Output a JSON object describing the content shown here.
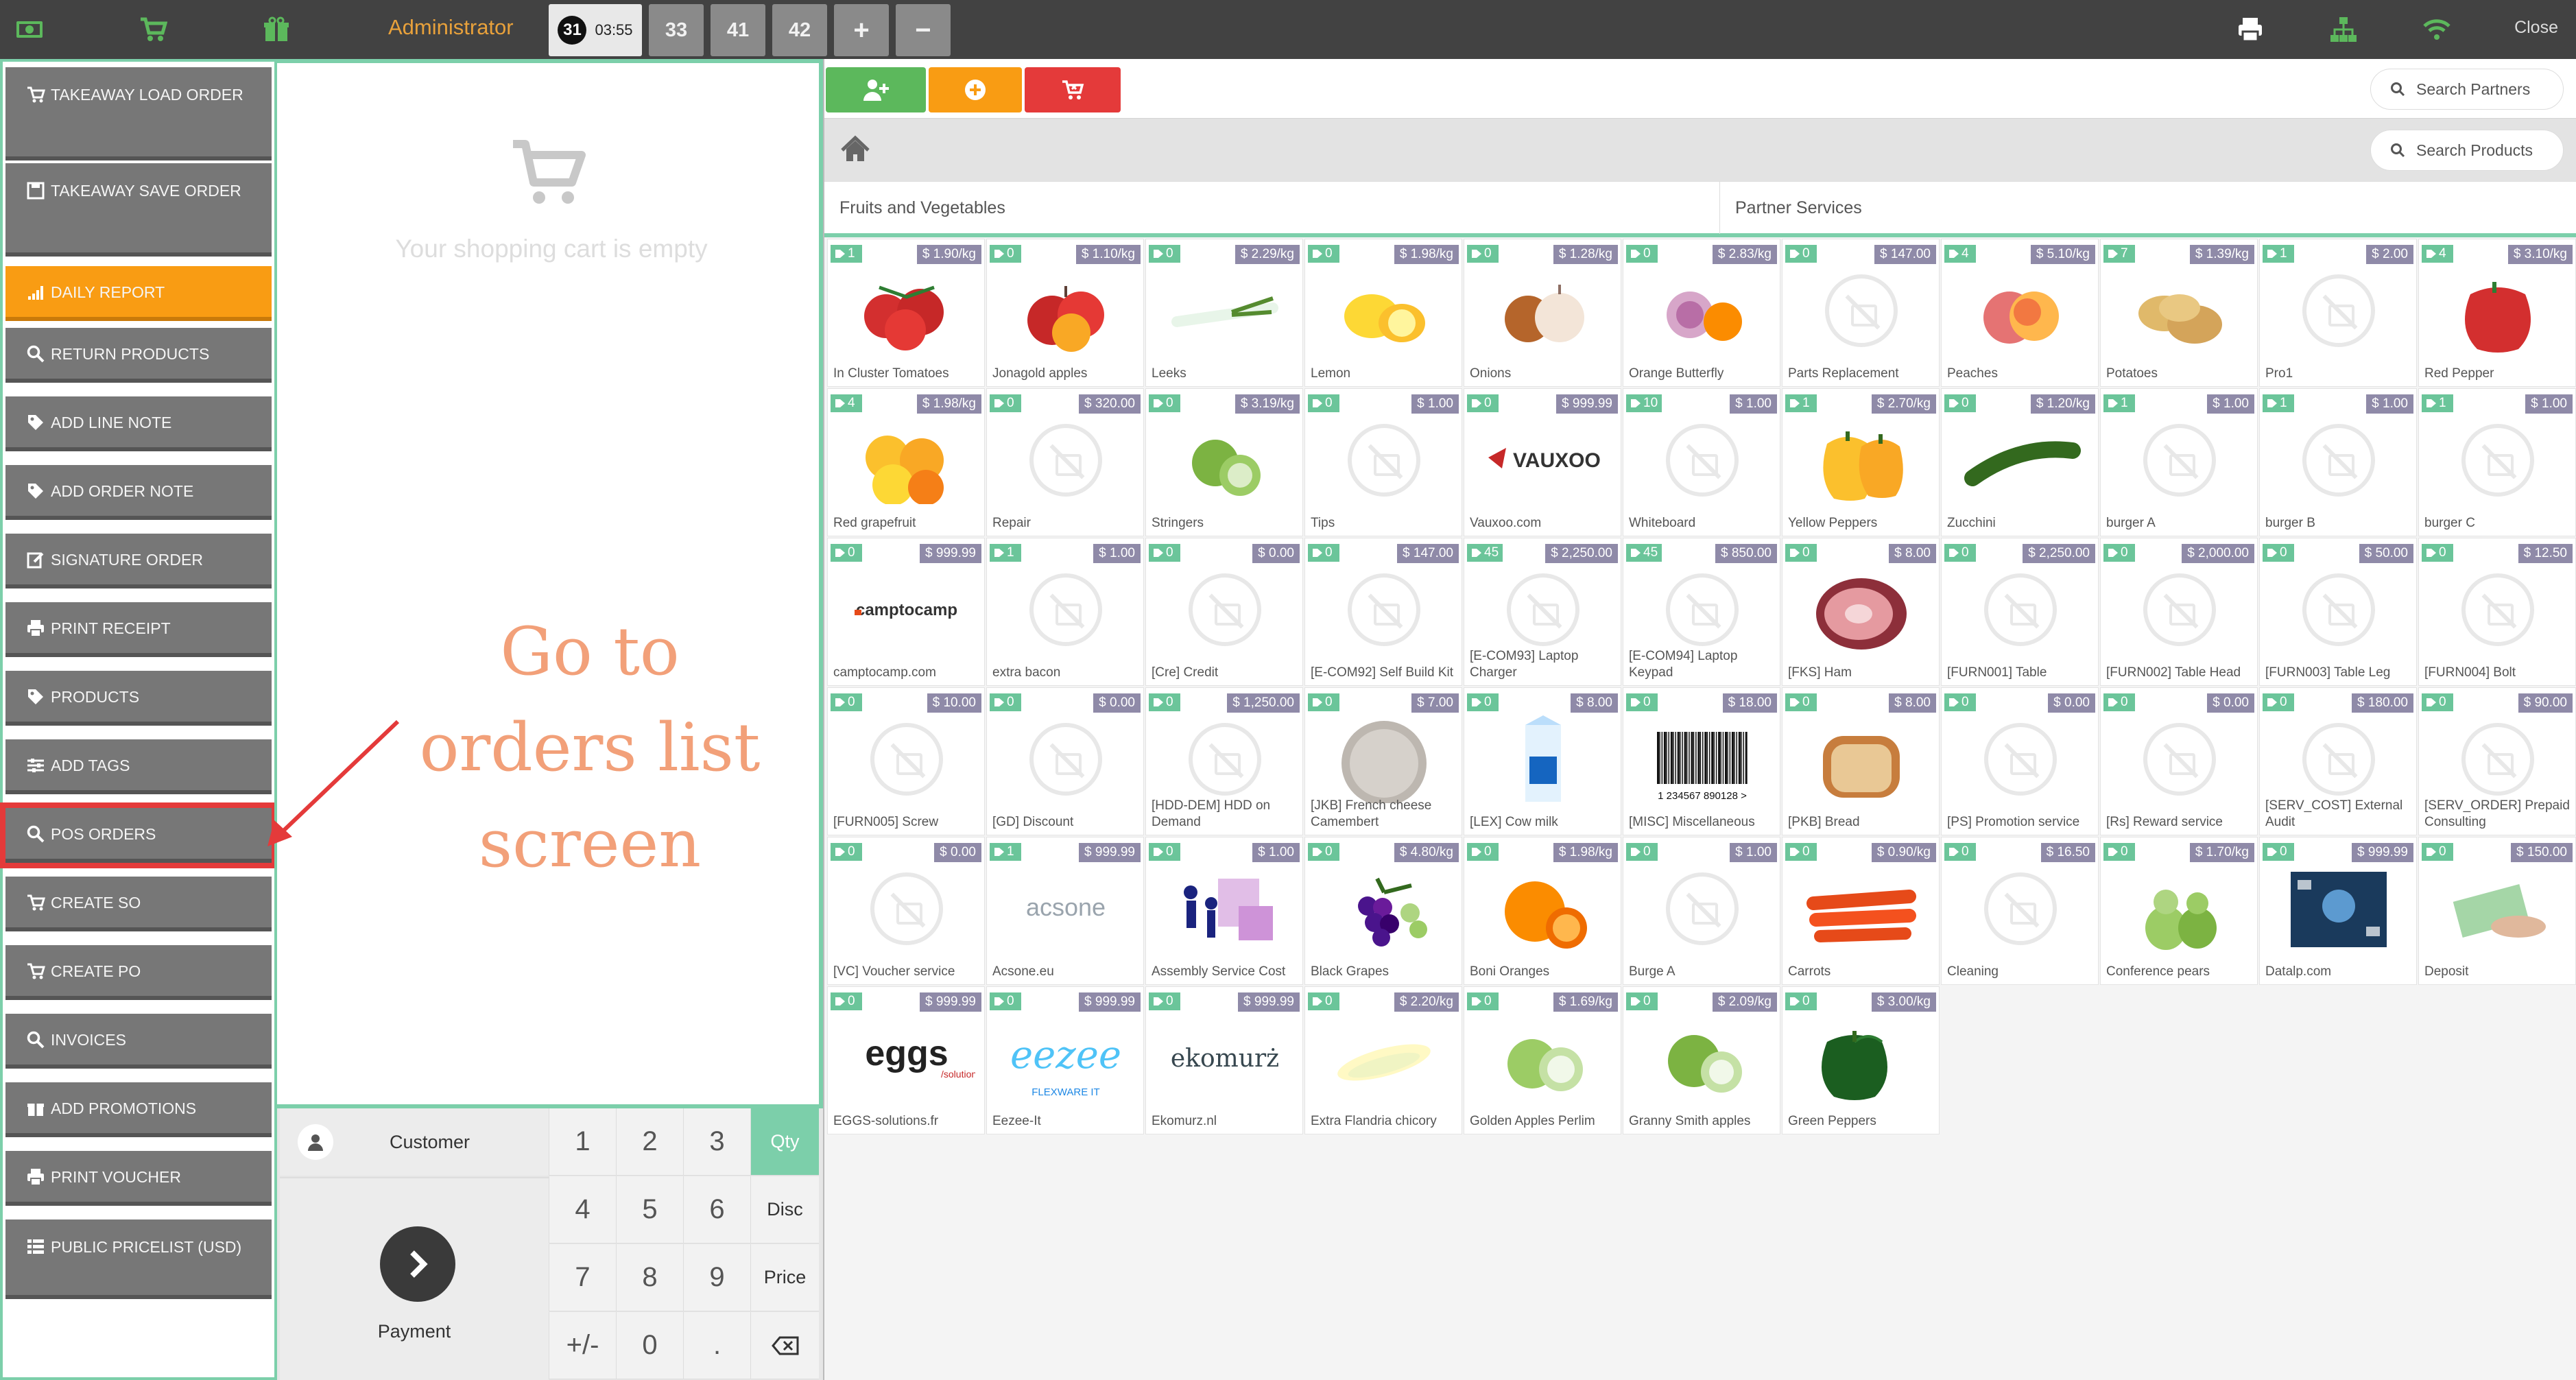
{
  "topbar": {
    "user": "Administrator",
    "tabs": [
      {
        "num": "31",
        "time": "03:55",
        "active": true
      },
      {
        "label": "33"
      },
      {
        "label": "41"
      },
      {
        "label": "42"
      },
      {
        "label": "+"
      },
      {
        "label": "−"
      }
    ],
    "close_label": "Close",
    "icons": [
      "money-icon",
      "cart-icon",
      "gift-icon",
      "printer-icon",
      "sitemap-icon",
      "wifi-icon"
    ]
  },
  "sidebar": {
    "items": [
      {
        "label": "TAKEAWAY LOAD ORDER",
        "icon": "cart-icon"
      },
      {
        "label": "TAKEAWAY SAVE ORDER",
        "icon": "save-icon"
      },
      {
        "label": "DAILY REPORT",
        "icon": "signal-icon"
      },
      {
        "label": "RETURN PRODUCTS",
        "icon": "search-icon"
      },
      {
        "label": "ADD LINE NOTE",
        "icon": "tag-icon"
      },
      {
        "label": "ADD ORDER NOTE",
        "icon": "tag-icon"
      },
      {
        "label": "SIGNATURE ORDER",
        "icon": "edit-icon"
      },
      {
        "label": "PRINT RECEIPT",
        "icon": "printer-icon"
      },
      {
        "label": "PRODUCTS",
        "icon": "tag-icon"
      },
      {
        "label": "ADD TAGS",
        "icon": "sliders-icon"
      },
      {
        "label": "POS ORDERS",
        "icon": "search-icon"
      },
      {
        "label": "CREATE SO",
        "icon": "cart-icon"
      },
      {
        "label": "CREATE PO",
        "icon": "cart-icon"
      },
      {
        "label": "INVOICES",
        "icon": "search-icon"
      },
      {
        "label": "ADD PROMOTIONS",
        "icon": "gift-icon"
      },
      {
        "label": "PRINT VOUCHER",
        "icon": "printer-icon"
      },
      {
        "label": "PUBLIC PRICELIST (USD)",
        "icon": "list-icon"
      }
    ]
  },
  "cart": {
    "empty_text": "Your shopping cart is empty"
  },
  "annotation": {
    "line1": "Go to",
    "line2": "orders list",
    "line3": "screen"
  },
  "numpad": {
    "customer_label": "Customer",
    "payment_label": "Payment",
    "keys": [
      "1",
      "2",
      "3",
      "4",
      "5",
      "6",
      "7",
      "8",
      "9",
      "+/-",
      "0",
      "."
    ],
    "modes": [
      "Qty",
      "Disc",
      "Price"
    ],
    "active_mode": "Qty"
  },
  "search": {
    "partners_placeholder": "Search Partners",
    "products_placeholder": "Search Products"
  },
  "categories": [
    "Fruits and Vegetables",
    "Partner Services"
  ],
  "colors": {
    "accent": "#7ccfaa",
    "orange": "#f99c13",
    "red": "#e43a3a",
    "green_btn": "#5cb85c",
    "topbar": "#424242"
  },
  "products": [
    {
      "name": "In Cluster Tomatoes",
      "price": "$ 1.90/kg",
      "qty": "1",
      "img": "tomato"
    },
    {
      "name": "Jonagold apples",
      "price": "$ 1.10/kg",
      "qty": "0",
      "img": "apple"
    },
    {
      "name": "Leeks",
      "price": "$ 2.29/kg",
      "qty": "0",
      "img": "leek"
    },
    {
      "name": "Lemon",
      "price": "$ 1.98/kg",
      "qty": "0",
      "img": "lemon"
    },
    {
      "name": "Onions",
      "price": "$ 1.28/kg",
      "qty": "0",
      "img": "onion"
    },
    {
      "name": "Orange Butterfly",
      "price": "$ 2.83/kg",
      "qty": "0",
      "img": "orangeb"
    },
    {
      "name": "Parts Replacement",
      "price": "$ 147.00",
      "qty": "0",
      "img": "ph"
    },
    {
      "name": "Peaches",
      "price": "$ 5.10/kg",
      "qty": "4",
      "img": "peach"
    },
    {
      "name": "Potatoes",
      "price": "$ 1.39/kg",
      "qty": "7",
      "img": "potato"
    },
    {
      "name": "Pro1",
      "price": "$ 2.00",
      "qty": "1",
      "img": "ph"
    },
    {
      "name": "Red Pepper",
      "price": "$ 3.10/kg",
      "qty": "4",
      "img": "redpepper"
    },
    {
      "name": "Red grapefruit",
      "price": "$ 1.98/kg",
      "qty": "4",
      "img": "grapefruit"
    },
    {
      "name": "Repair",
      "price": "$ 320.00",
      "qty": "0",
      "img": "ph"
    },
    {
      "name": "Stringers",
      "price": "$ 3.19/kg",
      "qty": "0",
      "img": "lime"
    },
    {
      "name": "Tips",
      "price": "$ 1.00",
      "qty": "0",
      "img": "ph"
    },
    {
      "name": "Vauxoo.com",
      "price": "$ 999.99",
      "qty": "0",
      "img": "vauxoo"
    },
    {
      "name": "Whiteboard",
      "price": "$ 1.00",
      "qty": "10",
      "img": "ph"
    },
    {
      "name": "Yellow Peppers",
      "price": "$ 2.70/kg",
      "qty": "1",
      "img": "yellowpepper"
    },
    {
      "name": "Zucchini",
      "price": "$ 1.20/kg",
      "qty": "0",
      "img": "zucchini"
    },
    {
      "name": "burger A",
      "price": "$ 1.00",
      "qty": "1",
      "img": "ph"
    },
    {
      "name": "burger B",
      "price": "$ 1.00",
      "qty": "1",
      "img": "ph"
    },
    {
      "name": "burger C",
      "price": "$ 1.00",
      "qty": "1",
      "img": "ph"
    },
    {
      "name": "camptocamp.com",
      "price": "$ 999.99",
      "qty": "0",
      "img": "camptocamp"
    },
    {
      "name": "extra bacon",
      "price": "$ 1.00",
      "qty": "1",
      "img": "ph"
    },
    {
      "name": "[Cre] Credit",
      "price": "$ 0.00",
      "qty": "0",
      "img": "ph"
    },
    {
      "name": "[E-COM92] Self Build Kit",
      "price": "$ 147.00",
      "qty": "0",
      "img": "ph"
    },
    {
      "name": "[E-COM93] Laptop Charger",
      "price": "$ 2,250.00",
      "qty": "45",
      "img": "ph"
    },
    {
      "name": "[E-COM94] Laptop Keypad",
      "price": "$ 850.00",
      "qty": "45",
      "img": "ph"
    },
    {
      "name": "[FKS] Ham",
      "price": "$ 8.00",
      "qty": "0",
      "img": "ham"
    },
    {
      "name": "[FURN001] Table",
      "price": "$ 2,250.00",
      "qty": "0",
      "img": "ph"
    },
    {
      "name": "[FURN002] Table Head",
      "price": "$ 2,000.00",
      "qty": "0",
      "img": "ph"
    },
    {
      "name": "[FURN003] Table Leg",
      "price": "$ 50.00",
      "qty": "0",
      "img": "ph"
    },
    {
      "name": "[FURN004] Bolt",
      "price": "$ 12.50",
      "qty": "0",
      "img": "ph"
    },
    {
      "name": "[FURN005] Screw",
      "price": "$ 10.00",
      "qty": "0",
      "img": "ph"
    },
    {
      "name": "[GD] Discount",
      "price": "$ 0.00",
      "qty": "0",
      "img": "ph"
    },
    {
      "name": "[HDD-DEM] HDD on Demand",
      "price": "$ 1,250.00",
      "qty": "0",
      "img": "ph"
    },
    {
      "name": "[JKB] French cheese Camembert",
      "price": "$ 7.00",
      "qty": "0",
      "img": "cheese"
    },
    {
      "name": "[LEX] Cow milk",
      "price": "$ 8.00",
      "qty": "0",
      "img": "milk"
    },
    {
      "name": "[MISC] Miscellaneous",
      "price": "$ 18.00",
      "qty": "0",
      "img": "barcode",
      "barcode": "1 234567 890128 >"
    },
    {
      "name": "[PKB] Bread",
      "price": "$ 8.00",
      "qty": "0",
      "img": "bread"
    },
    {
      "name": "[PS] Promotion service",
      "price": "$ 0.00",
      "qty": "0",
      "img": "ph"
    },
    {
      "name": "[Rs] Reward service",
      "price": "$ 0.00",
      "qty": "0",
      "img": "ph"
    },
    {
      "name": "[SERV_COST] External Audit",
      "price": "$ 180.00",
      "qty": "0",
      "img": "ph"
    },
    {
      "name": "[SERV_ORDER] Prepaid Consulting",
      "price": "$ 90.00",
      "qty": "0",
      "img": "ph"
    },
    {
      "name": "[VC] Voucher service",
      "price": "$ 0.00",
      "qty": "0",
      "img": "ph"
    },
    {
      "name": "Acsone.eu",
      "price": "$ 999.99",
      "qty": "1",
      "img": "acsone"
    },
    {
      "name": "Assembly Service Cost",
      "price": "$ 1.00",
      "qty": "0",
      "img": "assembly"
    },
    {
      "name": "Black Grapes",
      "price": "$ 4.80/kg",
      "qty": "0",
      "img": "grapes"
    },
    {
      "name": "Boni Oranges",
      "price": "$ 1.98/kg",
      "qty": "0",
      "img": "orange"
    },
    {
      "name": "Burge A",
      "price": "$ 1.00",
      "qty": "0",
      "img": "ph"
    },
    {
      "name": "Carrots",
      "price": "$ 0.90/kg",
      "qty": "0",
      "img": "carrot"
    },
    {
      "name": "Cleaning",
      "price": "$ 16.50",
      "qty": "0",
      "img": "ph"
    },
    {
      "name": "Conference pears",
      "price": "$ 1.70/kg",
      "qty": "0",
      "img": "pear"
    },
    {
      "name": "Datalp.com",
      "price": "$ 999.99",
      "qty": "0",
      "img": "datalp"
    },
    {
      "name": "Deposit",
      "price": "$ 150.00",
      "qty": "0",
      "img": "money"
    },
    {
      "name": "EGGS-solutions.fr",
      "price": "$ 999.99",
      "qty": "0",
      "img": "eggs"
    },
    {
      "name": "Eezee-It",
      "price": "$ 999.99",
      "qty": "0",
      "img": "eezee"
    },
    {
      "name": "Ekomurz.nl",
      "price": "$ 999.99",
      "qty": "0",
      "img": "ekomurz"
    },
    {
      "name": "Extra Flandria chicory",
      "price": "$ 2.20/kg",
      "qty": "0",
      "img": "chicory"
    },
    {
      "name": "Golden Apples Perlim",
      "price": "$ 1.69/kg",
      "qty": "0",
      "img": "greenapple"
    },
    {
      "name": "Granny Smith apples",
      "price": "$ 2.09/kg",
      "qty": "0",
      "img": "greenapple2"
    },
    {
      "name": "Green Peppers",
      "price": "$ 3.00/kg",
      "qty": "0",
      "img": "greenpepper"
    }
  ]
}
